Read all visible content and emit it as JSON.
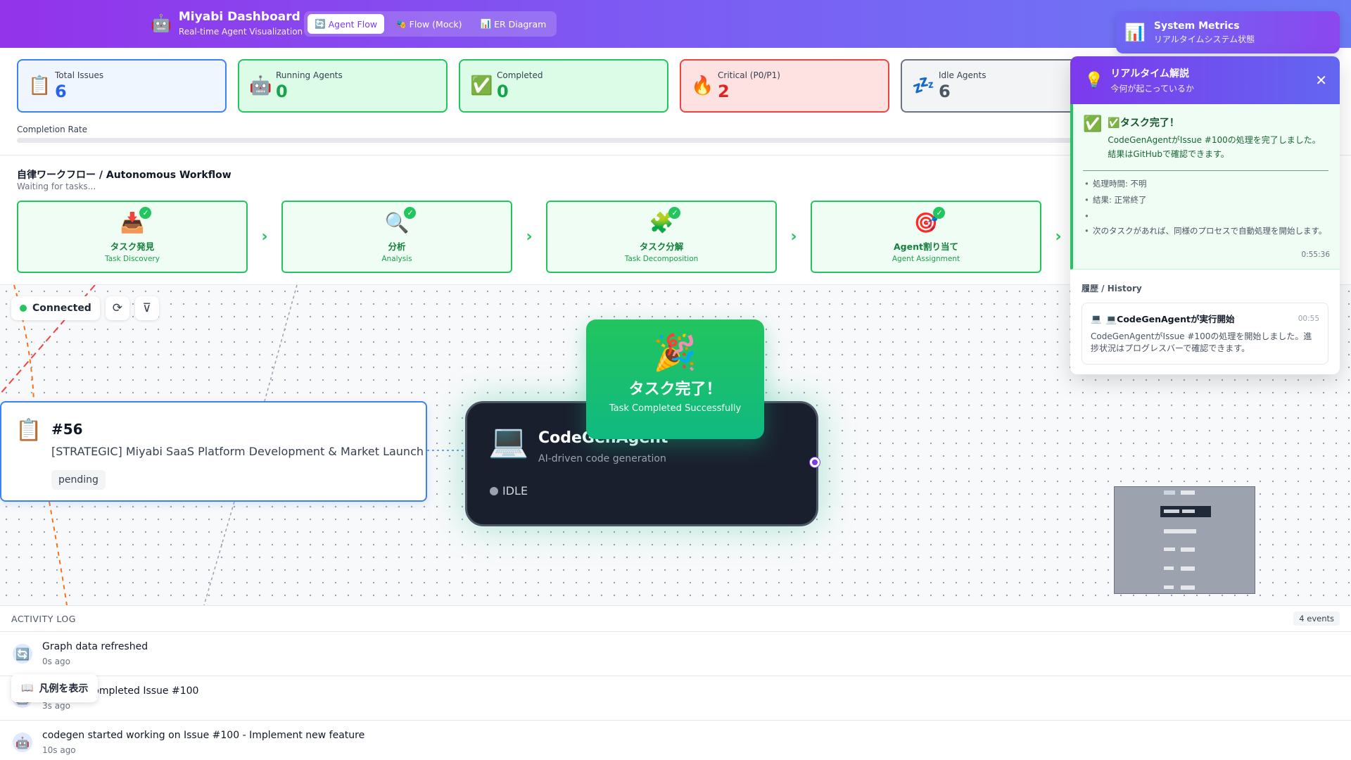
{
  "header": {
    "brand_icon": "🤖",
    "title": "Miyabi Dashboard",
    "subtitle": "Real-time Agent Visualization",
    "tabs": [
      {
        "icon": "🔄",
        "label": "Agent Flow"
      },
      {
        "icon": "🎭",
        "label": "Flow (Mock)"
      },
      {
        "icon": "📊",
        "label": "ER Diagram"
      }
    ],
    "active_tab": "Agent Flow"
  },
  "metrics_button": {
    "icon": "📊",
    "title": "System Metrics",
    "subtitle": "リアルタイムシステム状態"
  },
  "stats": [
    {
      "icon": "📋",
      "label": "Total Issues",
      "value": "6"
    },
    {
      "icon": "🤖",
      "label": "Running Agents",
      "value": "0"
    },
    {
      "icon": "✅",
      "label": "Completed",
      "value": "0"
    },
    {
      "icon": "🔥",
      "label": "Critical (P0/P1)",
      "value": "2"
    },
    {
      "icon": "💤",
      "label": "Idle Agents",
      "value": "6"
    }
  ],
  "completion": {
    "label": "Completion Rate",
    "value_percent": 0
  },
  "workflow": {
    "title": "自律ワークフロー / Autonomous Workflow",
    "subtitle": "Waiting for tasks...",
    "steps": [
      {
        "icon": "📥",
        "jp": "タスク発見",
        "en": "Task Discovery"
      },
      {
        "icon": "🔍",
        "jp": "分析",
        "en": "Analysis"
      },
      {
        "icon": "🧩",
        "jp": "タスク分解",
        "en": "Task Decomposition"
      },
      {
        "icon": "🎯",
        "jp": "Agent割り当て",
        "en": "Agent Assignment"
      }
    ],
    "arrow": "›",
    "check": "✓"
  },
  "canvas": {
    "connection_status": "Connected",
    "refresh_icon": "⟳",
    "filter_icon": "⊽",
    "issue_node": {
      "icon": "📋",
      "number": "#56",
      "title": "[STRATEGIC] Miyabi SaaS Platform Development & Market Launch",
      "status": "pending"
    },
    "agent_node": {
      "icon": "💻",
      "name": "CodeGenAgent",
      "description": "AI-driven code generation",
      "status": "IDLE"
    },
    "celebration": {
      "icon": "🎉",
      "title": "タスク完了！",
      "subtitle": "Task Completed Successfully"
    }
  },
  "realtime_panel": {
    "icon": "💡",
    "title": "リアルタイム解説",
    "subtitle": "今何が起こっているか",
    "close_icon": "✕",
    "current": {
      "icon": "✅",
      "title": "✅タスク完了！",
      "description": "CodeGenAgentがIssue #100の処理を完了しました。結果はGitHubで確認できます。",
      "details": [
        "処理時間: 不明",
        "結果: 正常終了",
        "",
        "次のタスクがあれば、同様のプロセスで自動処理を開始します。"
      ],
      "time": "0:55:36"
    },
    "history_title": "履歴 / History",
    "history": [
      {
        "icon": "💻",
        "title": "💻CodeGenAgentが実行開始",
        "time": "00:55",
        "description": "CodeGenAgentがIssue #100の処理を開始しました。進捗状況はプログレスバーで確認できます。"
      }
    ]
  },
  "activity_log": {
    "title": "ACTIVITY LOG",
    "count": "4 events",
    "items": [
      {
        "icon": "🔄",
        "message": "Graph data refreshed",
        "time": "0s ago"
      },
      {
        "icon": "🤖",
        "message": "codegen completed Issue #100",
        "time": "3s ago"
      },
      {
        "icon": "🤖",
        "message": "codegen started working on Issue #100 - Implement new feature",
        "time": "10s ago"
      }
    ]
  },
  "legend_button": {
    "icon": "📖",
    "label": "凡例を表示"
  }
}
